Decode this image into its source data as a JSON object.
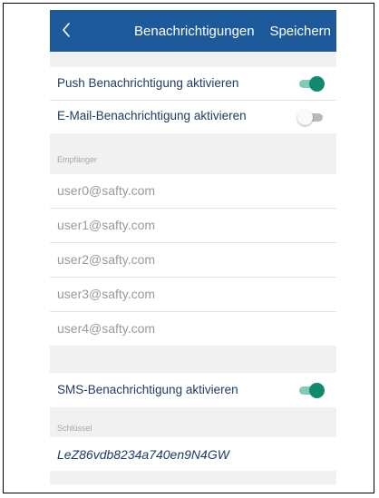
{
  "header": {
    "title": "Benachrichtigungen",
    "save_label": "Speichern"
  },
  "settings": {
    "push": {
      "label": "Push Benachrichtigung aktivieren",
      "enabled": true
    },
    "email": {
      "label": "E-Mail-Benachrichtigung aktivieren",
      "enabled": false
    },
    "sms": {
      "label": "SMS-Benachrichtigung aktivieren",
      "enabled": true
    }
  },
  "recipients": {
    "section_label": "Empfänger",
    "items": [
      "user0@safty.com",
      "user1@safty.com",
      "user2@safty.com",
      "user3@safty.com",
      "user4@safty.com"
    ]
  },
  "key": {
    "section_label": "Schlüssel",
    "value": "LeZ86vdb8234a740en9N4GW"
  },
  "colors": {
    "navbar": "#1d5a9b",
    "toggle_on": "#0f8a6c",
    "background": "#f1f1f1"
  },
  "icons": {
    "back": "chevron-left-icon"
  }
}
